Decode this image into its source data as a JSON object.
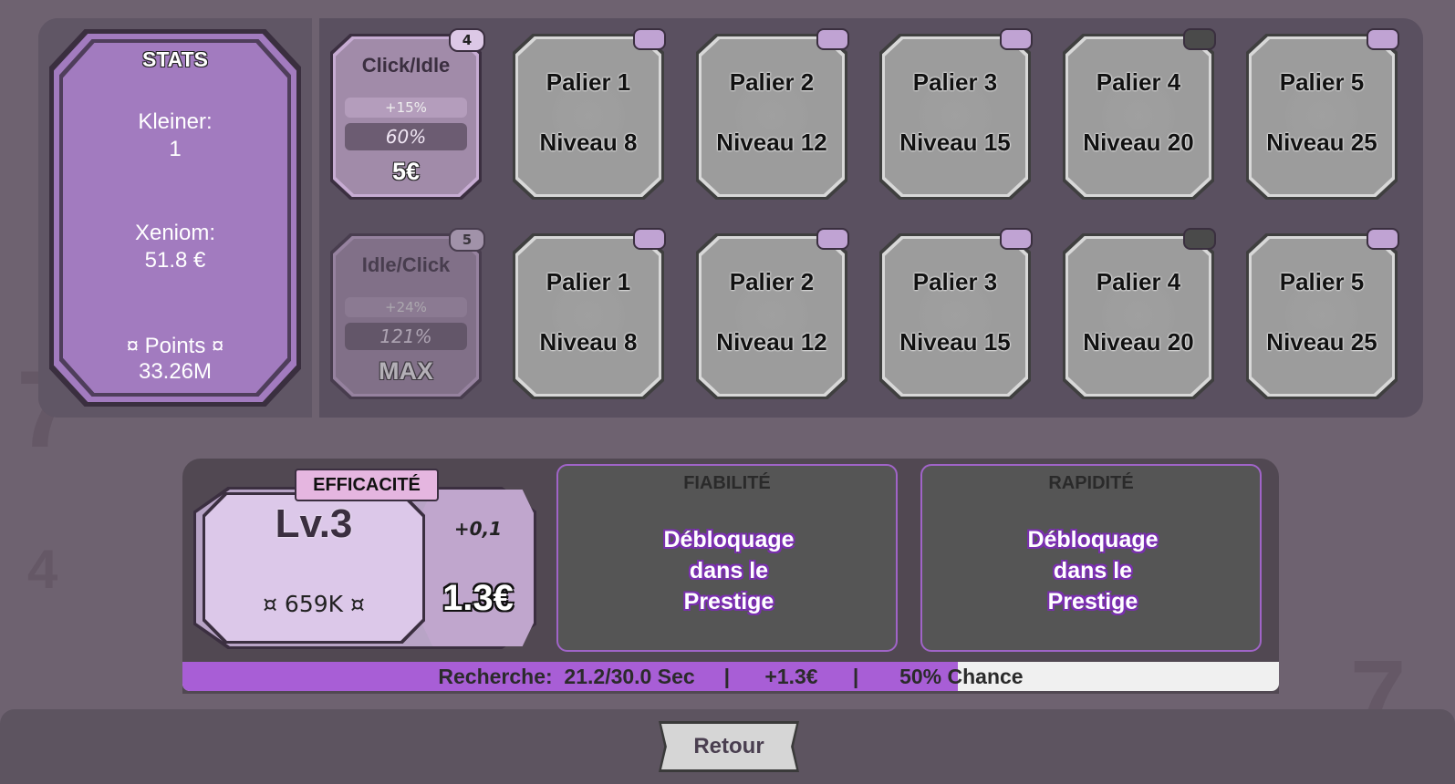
{
  "stats": {
    "title": "STATS",
    "kleiner_label": "Kleiner:",
    "kleiner_value": "1",
    "xeniom_label": "Xeniom:",
    "xeniom_value": "51.8 €",
    "points_label": "¤ Points ¤",
    "points_value": "33.26M"
  },
  "upgrades": [
    {
      "title": "Click/Idle",
      "badge": "4",
      "bonus": "+15%",
      "total": "60%",
      "cost": "5€",
      "enabled": true
    },
    {
      "title": "Idle/Click",
      "badge": "5",
      "bonus": "+24%",
      "total": "121%",
      "cost": "MAX",
      "enabled": false
    }
  ],
  "tiers_row1": [
    {
      "title": "Palier 1",
      "level": "Niveau 8"
    },
    {
      "title": "Palier 2",
      "level": "Niveau 12"
    },
    {
      "title": "Palier 3",
      "level": "Niveau 15"
    },
    {
      "title": "Palier 4",
      "level": "Niveau 20"
    },
    {
      "title": "Palier 5",
      "level": "Niveau 25"
    }
  ],
  "tiers_row2": [
    {
      "title": "Palier 1",
      "level": "Niveau 8"
    },
    {
      "title": "Palier 2",
      "level": "Niveau 12"
    },
    {
      "title": "Palier 3",
      "level": "Niveau 15"
    },
    {
      "title": "Palier 4",
      "level": "Niveau 20"
    },
    {
      "title": "Palier 5",
      "level": "Niveau 25"
    }
  ],
  "efficiency": {
    "tab": "EFFICACITÉ",
    "level": "Lv.3",
    "cost": "¤ 659K ¤",
    "delta": "+0,1",
    "value": "1.3€"
  },
  "reliability": {
    "title": "FIABILITÉ",
    "line1": "Débloquage",
    "line2": "dans le",
    "line3": "Prestige"
  },
  "speed": {
    "title": "RAPIDITÉ",
    "line1": "Débloquage",
    "line2": "dans le",
    "line3": "Prestige"
  },
  "research": {
    "text": "Recherche:  21.2/30.0 Sec     |      +1.3€      |       50% Chance",
    "progress": 0.707
  },
  "footer": {
    "back_label": "Retour"
  },
  "colors": {
    "accent": "#a85ed6",
    "stats_fill": "#a27bbf",
    "locked_border": "#a064c8"
  }
}
